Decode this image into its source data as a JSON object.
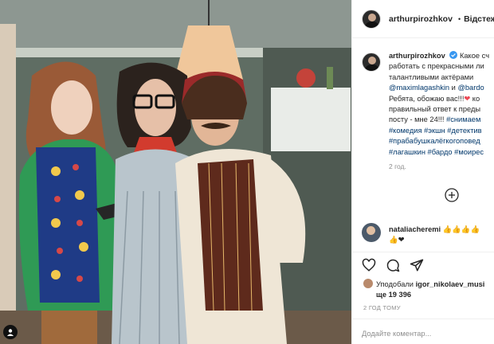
{
  "post": {
    "username": "arthurpirozhkov",
    "follow_separator": "•",
    "follow_label": "Відстеж",
    "verified": true
  },
  "caption": {
    "username": "arthurpirozhkov",
    "line1": "Какое сч",
    "line2": "работать с прекрасными ли",
    "line3": "талантливыми актёрами",
    "line4_link1": "@maximlagashkin",
    "line4_and": " и ",
    "line4_link2": "@bardo",
    "line5_text": "Ребята, обожаю вас!!!",
    "line5_tail": " ко",
    "line6": "правильный ответ к преды",
    "line7_text": "посту - мне 24!!! ",
    "line7_tag": "#снимаем",
    "line8": "#комедия #экшн #детектив",
    "line9": "#прабабушкалёгкогоповед",
    "line10": "#лагашкин #бардо #моирес",
    "time": "2 год."
  },
  "comment": {
    "username": "nataliacheremi",
    "emojis_line1": "👍👍👍👍",
    "emojis_line2": "👍❤"
  },
  "likes": {
    "prefix": "Уподобали ",
    "username": "igor_nikolaev_musi",
    "line2": "ще 19 396"
  },
  "time_ago": "2 год тому",
  "add_comment_placeholder": "Додайте коментар...",
  "icons": [
    "verified-icon",
    "more-circle-icon",
    "heart-icon",
    "comment-icon",
    "share-icon"
  ],
  "colors": {
    "link": "#00376b",
    "verified": "#3897f0",
    "heart": "#ed4956",
    "muted": "#8e8e8e"
  }
}
